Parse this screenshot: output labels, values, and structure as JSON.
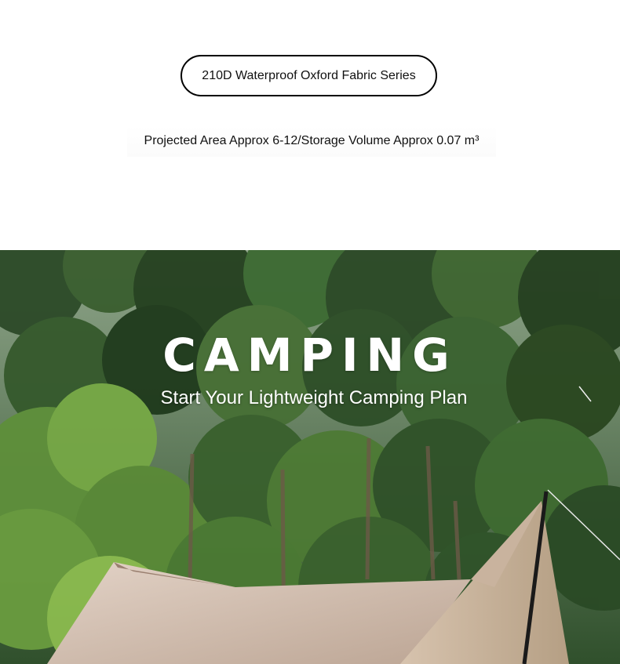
{
  "top": {
    "series_label": "210D Waterproof Oxford Fabric Series",
    "spec_text": "Projected Area Approx 6-12/Storage Volume Approx 0.07 m³"
  },
  "hero": {
    "title": "CAMPING",
    "subtitle": "Start Your Lightweight Camping Plan",
    "image": "forest-tent-photo",
    "colors": {
      "foliage_dark": "#1f3b1f",
      "foliage_mid": "#3f6b2e",
      "foliage_light": "#7fae45",
      "tent": "#c9b3a3"
    }
  }
}
